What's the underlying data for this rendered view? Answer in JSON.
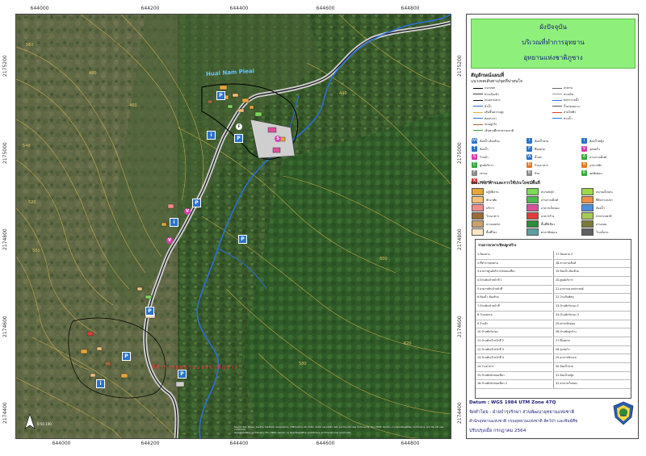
{
  "map": {
    "x_ticks_top": [
      "644000",
      "644200",
      "644400",
      "644600",
      "644800"
    ],
    "x_ticks_bottom": [
      "644000",
      "644200",
      "644400",
      "644600",
      "644800"
    ],
    "y_ticks_left": [
      "2175200",
      "2175000",
      "2174800",
      "2174600",
      "2174400"
    ],
    "y_ticks_right": [
      "2175200",
      "2175000",
      "2174800",
      "2174600",
      "2174400"
    ],
    "stream_label": "Huai Nam Pieai",
    "red_label": "ที่ทำการอุทยานแห่งชาติภูซาง",
    "contour_labels": [
      "560",
      "540",
      "520",
      "500",
      "480",
      "460",
      "440",
      "600",
      "620",
      "580"
    ],
    "attribution_line1": "Source: Esri, Maxar, GeoEye, Earthstar Geographics, CNES/Airbus DS, USDA, USGS, AeroGRID, IGN, and the GIS User Community, Esri, HERE, Garmin, (c) OpenStreetMap contributors, and the GIS user community",
    "attribution_line2": "OpenStreetMap contributors, Esri, HERE, Garmin, (c) OpenStreetMap contributors, and the GIS user community",
    "scale_text": "0 50 100",
    "north_arrow": "north-arrow-icon"
  },
  "panel": {
    "title_line1": "ผังปัจจุบัน",
    "title_line2": "บริเวณที่ทำการอุทยาน",
    "title_line3": "อุทยานแห่งชาติภูซาง",
    "legend_heading": "สัญลักษณ์แผนที่",
    "lines_heading": "แนวเขตเส้นทาง/จุดที่น่าสนใจ",
    "line_items": [
      "แนวเขต",
      "ทางเดินเท้า",
      "ถนนลาดยาง",
      "ลำน้ำ",
      "เส้นชั้นความสูง",
      "ท่อประปา",
      "ถนนลูกรัง",
      "เส้นทางศึกษาธรรมชาติ",
      "สะพาน",
      "ทางเดิน",
      "ท่อระบายน้ำ",
      "รั้วลวดหนาม",
      "สายไฟฟ้า",
      "ทางน้ำ"
    ],
    "point_items": [
      {
        "label": "ห้องน้ำ-ห้องส้วม",
        "color": "#2a73c9",
        "glyph": "WC"
      },
      {
        "label": "ห้องน้ำชาย",
        "color": "#2a73c9",
        "glyph": "i"
      },
      {
        "label": "ห้องน้ำหญิง",
        "color": "#2a73c9",
        "glyph": "i"
      },
      {
        "label": "ห้องน้ำ",
        "color": "#2a73c9",
        "glyph": "T"
      },
      {
        "label": "ที่จอดรถ",
        "color": "#2a73c9",
        "glyph": "P"
      },
      {
        "label": "จุดชมวิว",
        "color": "#d63fb0",
        "glyph": "V"
      },
      {
        "label": "ร้านค้า",
        "color": "#d63fb0",
        "glyph": "S"
      },
      {
        "label": "น้ำตก",
        "color": "#2a73c9",
        "glyph": "W"
      },
      {
        "label": "ลานกางเต็นท์",
        "color": "#3aa63a",
        "glyph": "A"
      },
      {
        "label": "ศูนย์บริการ",
        "color": "#3aa63a",
        "glyph": "C"
      },
      {
        "label": "ร้านอาหาร",
        "color": "#e07a22",
        "glyph": "R"
      },
      {
        "label": "อาคารพัก",
        "color": "#e07a22",
        "glyph": "H"
      },
      {
        "label": "เสาธง",
        "color": "#888888",
        "glyph": "F"
      },
      {
        "label": "ป้าย",
        "color": "#888888",
        "glyph": "B"
      },
      {
        "label": "จุดพักผ่อน",
        "color": "#3aa63a",
        "glyph": "R"
      },
      {
        "label": "รถดับเพลิง",
        "color": "#d63f3f",
        "glyph": "X"
      }
    ],
    "landuse_heading": "ประเภทอาคารและการใช้ประโยชน์พื้นที่",
    "landuse_items": [
      {
        "label": "ปฏิบัติงาน",
        "color": "#e8a53a"
      },
      {
        "label": "พักอาศัย",
        "color": "#f5c07a"
      },
      {
        "label": "บริการ",
        "color": "#f08c8c"
      },
      {
        "label": "โรงอาหาร",
        "color": "#9a6a3a"
      },
      {
        "label": "ลานจอดรถ",
        "color": "#c9a26e"
      },
      {
        "label": "พื้นที่โล่ง",
        "color": "#f7e6c0"
      },
      {
        "label": "สนามหญ้า",
        "color": "#7ed957"
      },
      {
        "label": "ลานกางเต็นท์",
        "color": "#4fb84f"
      },
      {
        "label": "อาคารเก็บของ",
        "color": "#d94f9a"
      },
      {
        "label": "อาคารร้าง",
        "color": "#e23c3c"
      },
      {
        "label": "พื้นที่สีเขียว",
        "color": "#2e8b3a"
      },
      {
        "label": "ศาลาพักผ่อน",
        "color": "#5f9ea0"
      },
      {
        "label": "สนามเด็กเล่น",
        "color": "#9cd84a"
      },
      {
        "label": "ที่ดินว่างเปล่า",
        "color": "#ed8e4a"
      },
      {
        "label": "ห้องน้ำ",
        "color": "#4a90d9"
      },
      {
        "label": "ป่าธรรมชาติ",
        "color": "#a7c957"
      },
      {
        "label": "ลานจอด",
        "color": "#7a7a3a"
      },
      {
        "label": "โรงเก็บรถ",
        "color": "#606060"
      }
    ],
    "table_header": "รายการอาคาร/สิ่งปลูกสร้าง",
    "table_col1": [
      "1.ป้อมยาม",
      "2.ที่ทำการอุทยาน",
      "3.อาคารศูนย์บริการนักท่องเที่ยว",
      "4.บ้านพักเจ้าหน้าที่ 1",
      "5.อาคารพักเจ้าหน้าที่",
      "6.ห้องน้ำ-ห้องส้วม",
      "7.บ้านพักเจ้าหน้าที่",
      "8.โรงจอดรถ",
      "9.ร้านค้า",
      "10.บ้านพักรับรอง",
      "11.บ้านพักเจ้าหน้าที่ 2",
      "12.บ้านพักเจ้าหน้าที่ 3",
      "13.บ้านพักเจ้าหน้าที่ 4",
      "14.โรงอาหาร",
      "15.บ้านพักนักท่องเที่ยว",
      "16.บ้านพักนักท่องเที่ยว 2"
    ],
    "table_col2": [
      "17.ป้อมยาม 2",
      "18.ลานกางเต็นท์",
      "19.ห้องน้ำ-ห้องส้วม",
      "20.ศูนย์บริการ",
      "21.อาคารอเนกประสงค์",
      "22.โรงเก็บพัสดุ",
      "23.บ้านพักรับรอง 2",
      "24.บ้านพักรับรอง 3",
      "25.ศาลาพักผ่อน",
      "26.บ้านพักลูกจ้าง",
      "27.ที่จอดรถ",
      "28.จุดชมวิว",
      "29.อาคารพักแรม",
      "30.ห้องน้ำชาย",
      "31.ห้องน้ำหญิง",
      "32.อาคารเก็บของ"
    ],
    "datum": "Datum  :  WGS 1984 UTM Zone 47Q",
    "made_by": "จัดทำโดย  :  ฝ่ายบำรุงรักษา ส่วนพัฒนาอุทยานแห่งชาติ",
    "office": "สำนักอุทยานแห่งชาติ  กรมอุทยานแห่งชาติ สัตว์ป่า และพันธุ์พืช",
    "updated": "ปรับปรุงเมื่อ  กรกฎาคม 2564"
  }
}
